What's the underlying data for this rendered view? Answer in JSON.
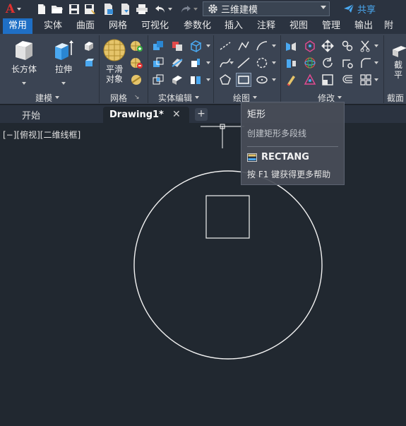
{
  "app": {
    "logo_letter": "A"
  },
  "workspace": {
    "label": "三维建模"
  },
  "share": {
    "label": "共享"
  },
  "ribbon_tabs": [
    "常用",
    "实体",
    "曲面",
    "网格",
    "可视化",
    "参数化",
    "插入",
    "注释",
    "视图",
    "管理",
    "输出",
    "附加"
  ],
  "ribbon": {
    "panels": {
      "modeling": "建模",
      "mesh": "网格",
      "solid_edit": "实体编辑",
      "draw": "绘图",
      "modify": "修改",
      "section": "截面"
    },
    "buttons": {
      "box": "长方体",
      "extrude": "拉伸",
      "smooth_line1": "平滑",
      "smooth_line2": "对象",
      "section_line1": "截",
      "section_line2": "平"
    }
  },
  "doc_tabs": {
    "start": "开始",
    "drawing": "Drawing1*"
  },
  "viewport": {
    "label": "[−][俯视][二维线框]"
  },
  "tooltip": {
    "title": "矩形",
    "description": "创建矩形多段线",
    "command": "RECTANG",
    "help": "按 F1 键获得更多帮助"
  },
  "colors": {
    "accent": "#1f6fc5",
    "share": "#4aa8f0",
    "logo": "#e0312f",
    "canvas": "#212830",
    "ribbon": "#3b4453"
  }
}
